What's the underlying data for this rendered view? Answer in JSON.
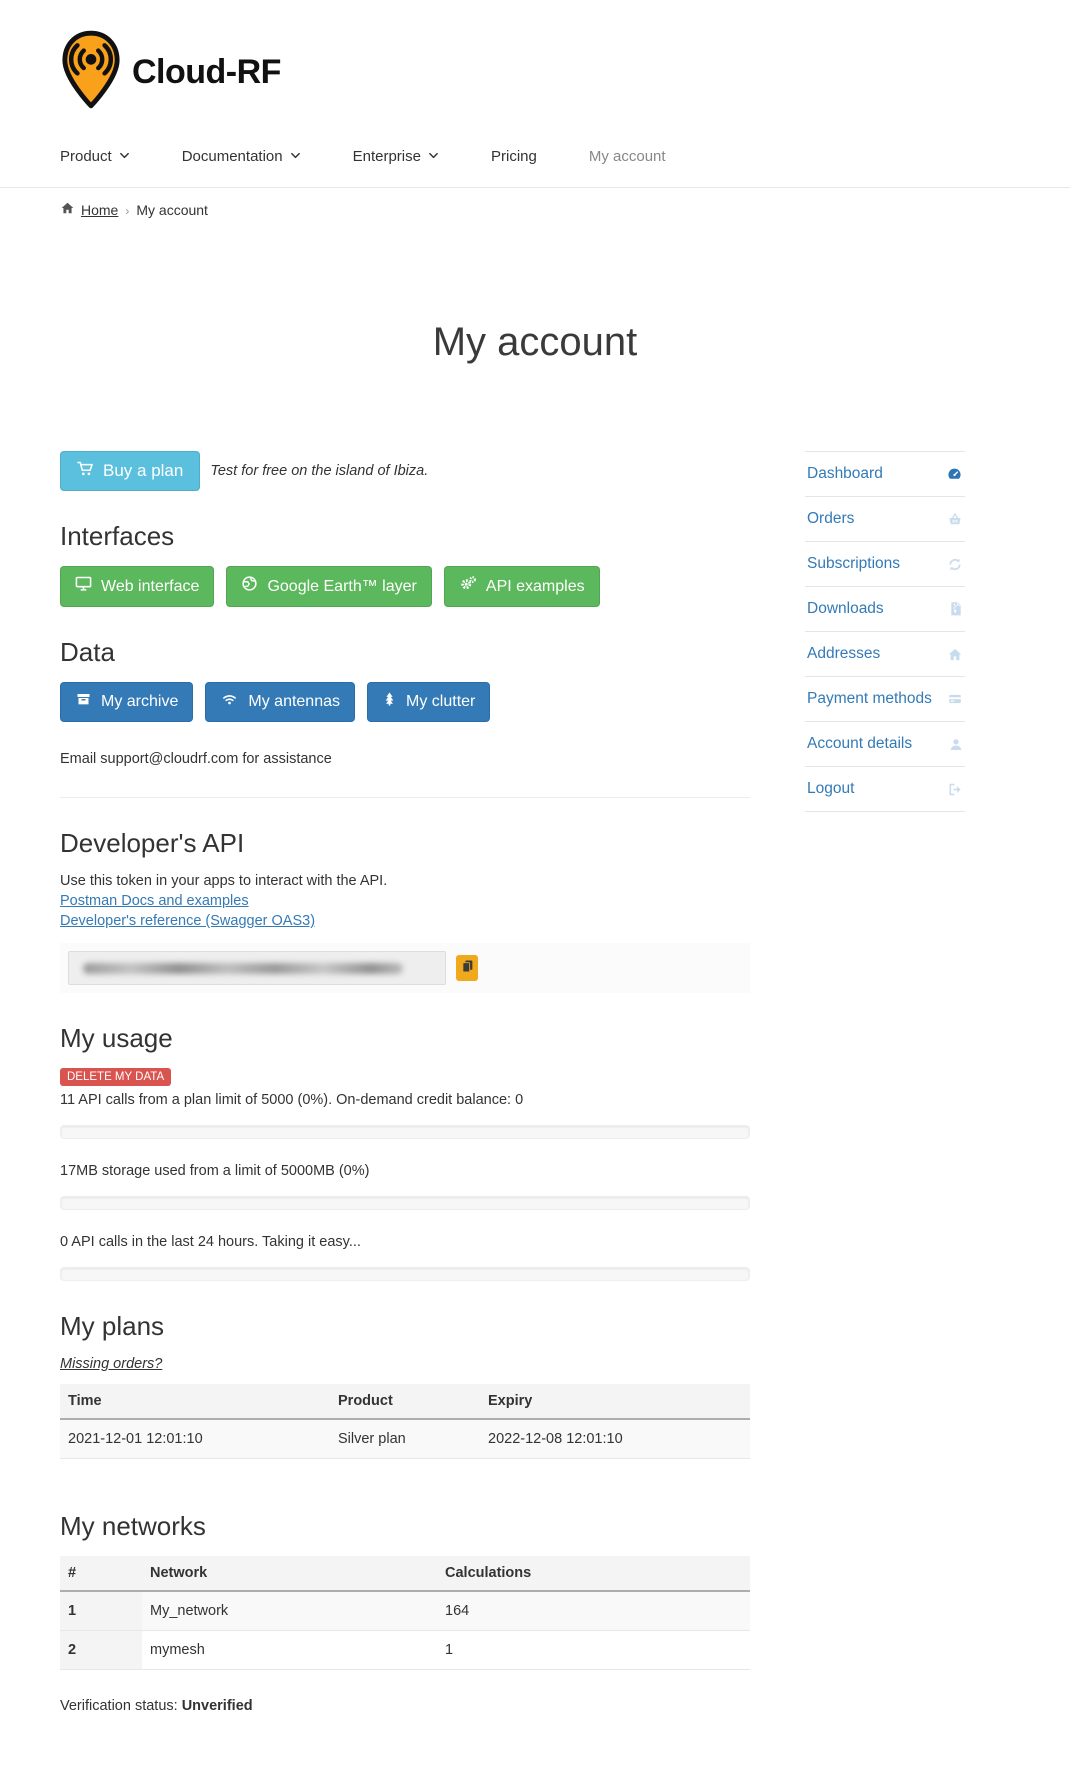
{
  "brand": {
    "name": "Cloud-RF",
    "logo_icon": "radio-pin-logo"
  },
  "nav": {
    "items": [
      {
        "label": "Product",
        "has_dropdown": true
      },
      {
        "label": "Documentation",
        "has_dropdown": true
      },
      {
        "label": "Enterprise",
        "has_dropdown": true
      },
      {
        "label": "Pricing",
        "has_dropdown": false
      },
      {
        "label": "My account",
        "has_dropdown": false,
        "active": true
      }
    ]
  },
  "breadcrumb": {
    "home_label": "Home",
    "separator": "›",
    "current": "My account"
  },
  "page": {
    "title": "My account"
  },
  "plan_banner": {
    "buy_button_label": "Buy a plan",
    "buy_button_icon": "cart-icon",
    "note": "Test for free on the island of Ibiza."
  },
  "interfaces": {
    "heading": "Interfaces",
    "buttons": [
      {
        "label": "Web interface",
        "icon": "monitor-icon"
      },
      {
        "label": "Google Earth™ layer",
        "icon": "globe-icon"
      },
      {
        "label": "API examples",
        "icon": "gears-icon"
      }
    ]
  },
  "data_section": {
    "heading": "Data",
    "buttons": [
      {
        "label": "My archive",
        "icon": "archive-icon"
      },
      {
        "label": "My antennas",
        "icon": "wifi-icon"
      },
      {
        "label": "My clutter",
        "icon": "tree-icon"
      }
    ],
    "support_note": "Email support@cloudrf.com for assistance"
  },
  "developer_api": {
    "heading": "Developer's API",
    "description": "Use this token in your apps to interact with the API.",
    "links": [
      "Postman Docs and examples",
      "Developer's reference (Swagger OAS3)"
    ],
    "copy_button_icon": "copy-icon",
    "token_state": "redacted"
  },
  "usage": {
    "heading": "My usage",
    "delete_button_label": "DELETE MY DATA",
    "api_calls_text": "11 API calls from a plan limit of 5000 (0%). On-demand credit balance: 0",
    "storage_text": "17MB storage used from a limit of 5000MB (0%)",
    "last24_text": "0 API calls in the last 24 hours. Taking it easy...",
    "progress_percents": [
      0,
      0,
      0
    ]
  },
  "plans": {
    "heading": "My plans",
    "missing_orders_link": "Missing orders?",
    "table": {
      "headers": [
        "Time",
        "Product",
        "Expiry"
      ],
      "rows": [
        [
          "2021-12-01 12:01:10",
          "Silver plan",
          "2022-12-08 12:01:10"
        ]
      ]
    }
  },
  "networks": {
    "heading": "My networks",
    "table": {
      "headers": [
        "#",
        "Network",
        "Calculations"
      ],
      "rows": [
        [
          "1",
          "My_network",
          "164"
        ],
        [
          "2",
          "mymesh",
          "1"
        ]
      ]
    }
  },
  "verification": {
    "label": "Verification status: ",
    "status": "Unverified"
  },
  "sidebar": {
    "items": [
      {
        "label": "Dashboard",
        "icon": "dashboard-icon",
        "active": true
      },
      {
        "label": "Orders",
        "icon": "basket-icon"
      },
      {
        "label": "Subscriptions",
        "icon": "sync-icon"
      },
      {
        "label": "Downloads",
        "icon": "zip-file-icon"
      },
      {
        "label": "Addresses",
        "icon": "home-icon"
      },
      {
        "label": "Payment methods",
        "icon": "credit-card-icon"
      },
      {
        "label": "Account details",
        "icon": "user-icon"
      },
      {
        "label": "Logout",
        "icon": "logout-icon"
      }
    ]
  },
  "colors": {
    "accent_blue": "#337ab7",
    "success_green": "#5cb85c",
    "info_cyan": "#5bc0de",
    "danger_red": "#d9534f",
    "warning_orange": "#f0a81c",
    "brand_orange": "#f9a11b"
  }
}
